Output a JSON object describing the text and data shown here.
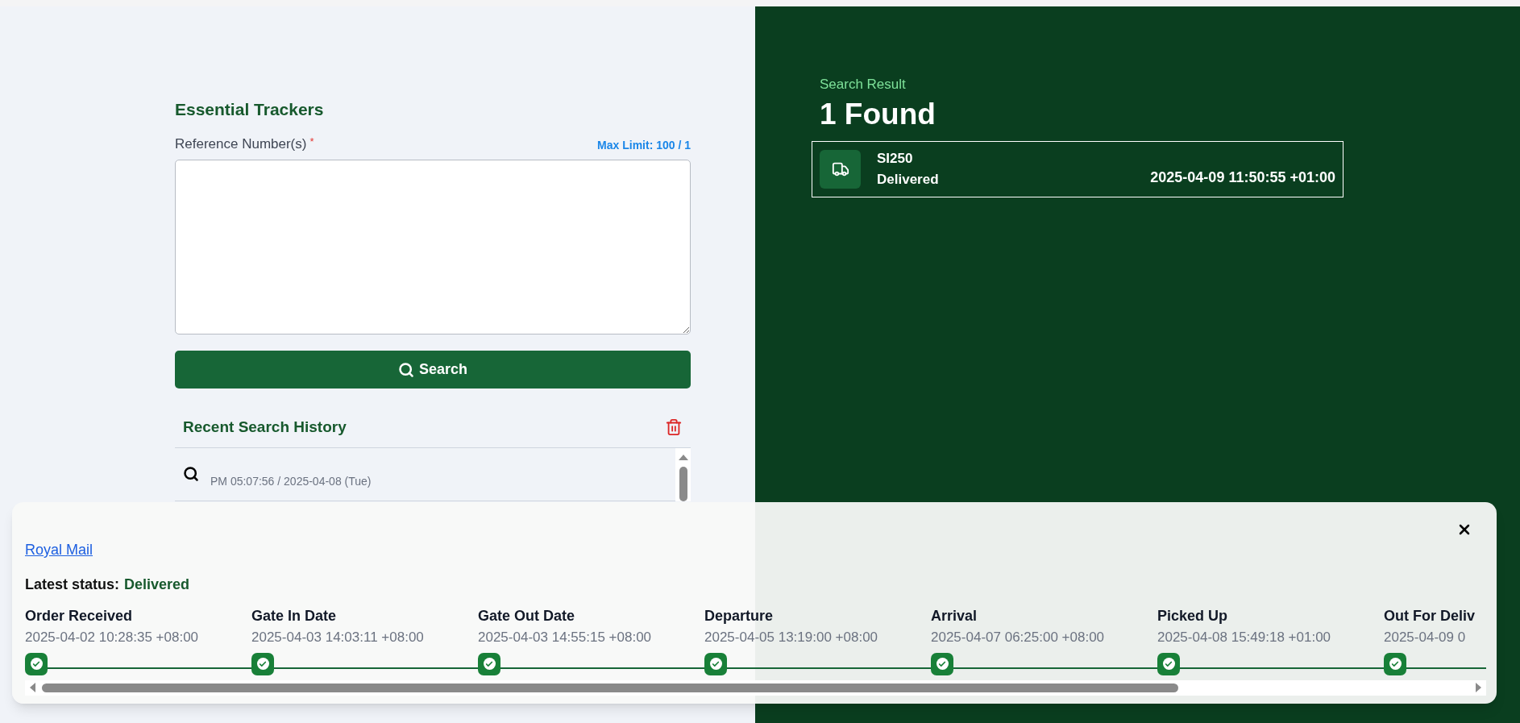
{
  "form": {
    "title": "Essential Trackers",
    "field_label": "Reference Number(s)",
    "required_mark": "*",
    "limit": "Max Limit: 100 / 1",
    "button": "Search"
  },
  "history": {
    "title": "Recent Search History",
    "items": [
      {
        "time": "PM 05:07:56 / 2025-04-08 (Tue)"
      }
    ]
  },
  "result": {
    "eyebrow": "Search Result",
    "count": "1 Found",
    "items": [
      {
        "reference": "SI250",
        "status": "Delivered",
        "time": "2025-04-09 11:50:55 +01:00"
      }
    ]
  },
  "detail": {
    "carrier": "Royal Mail",
    "status_label": "Latest status:",
    "status_value": "Delivered",
    "milestones": [
      {
        "label": "Order Received",
        "date": "2025-04-02 10:28:35 +08:00"
      },
      {
        "label": "Gate In Date",
        "date": "2025-04-03 14:03:11 +08:00"
      },
      {
        "label": "Gate Out Date",
        "date": "2025-04-03 14:55:15 +08:00"
      },
      {
        "label": "Departure",
        "date": "2025-04-05 13:19:00 +08:00"
      },
      {
        "label": "Arrival",
        "date": "2025-04-07 06:25:00 +08:00"
      },
      {
        "label": "Picked Up",
        "date": "2025-04-08 15:49:18 +01:00"
      },
      {
        "label": "Out For Deliv",
        "date": "2025-04-09 0"
      }
    ]
  }
}
